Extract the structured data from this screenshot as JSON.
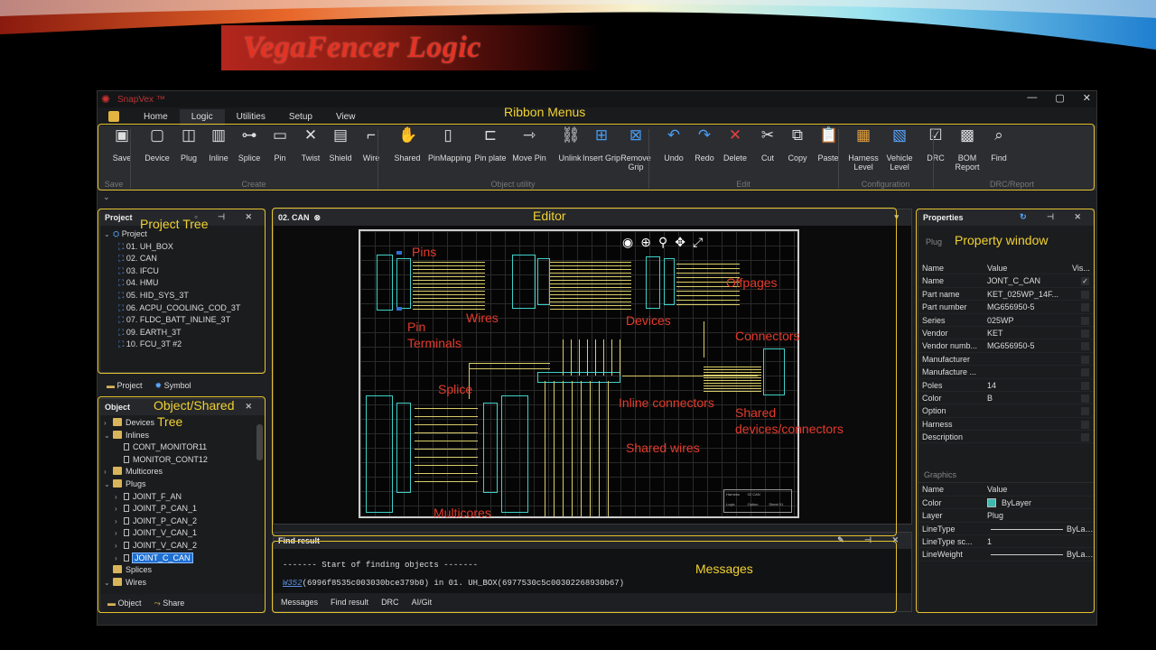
{
  "slide": {
    "title": "VegaFencer Logic"
  },
  "app": {
    "name": "SnapVex ™",
    "window_controls": [
      "—",
      "▢",
      "✕"
    ],
    "menu_tabs": [
      "Home",
      "Logic",
      "Utilities",
      "Setup",
      "View"
    ],
    "active_tab": "Logic"
  },
  "ribbon": {
    "buttons": [
      {
        "label": "Save",
        "icon": "save-icon"
      },
      {
        "label": "Device",
        "icon": "device-icon"
      },
      {
        "label": "Plug",
        "icon": "plug-icon"
      },
      {
        "label": "Inline",
        "icon": "inline-icon"
      },
      {
        "label": "Splice",
        "icon": "splice-icon"
      },
      {
        "label": "Pin",
        "icon": "pin-icon"
      },
      {
        "label": "Twist",
        "icon": "twist-icon"
      },
      {
        "label": "Shield",
        "icon": "shield-icon"
      },
      {
        "label": "Wire",
        "icon": "wire-icon"
      },
      {
        "label": "Shared",
        "icon": "shared-icon"
      },
      {
        "label": "PinMapping",
        "icon": "pinmapping-icon"
      },
      {
        "label": "Pin plate",
        "icon": "pin-plate-icon"
      },
      {
        "label": "Move Pin",
        "icon": "move-pin-icon"
      },
      {
        "label": "Unlink",
        "icon": "unlink-icon"
      },
      {
        "label": "Insert Grip",
        "icon": "insert-grip-icon"
      },
      {
        "label": "Remove Grip",
        "icon": "remove-grip-icon"
      },
      {
        "label": "Undo",
        "icon": "undo-icon"
      },
      {
        "label": "Redo",
        "icon": "redo-icon"
      },
      {
        "label": "Delete",
        "icon": "delete-icon"
      },
      {
        "label": "Cut",
        "icon": "cut-icon"
      },
      {
        "label": "Copy",
        "icon": "copy-icon"
      },
      {
        "label": "Paste",
        "icon": "paste-icon"
      },
      {
        "label": "Harness Level",
        "icon": "harness-level-icon"
      },
      {
        "label": "Vehicle Level",
        "icon": "vehicle-level-icon"
      },
      {
        "label": "DRC",
        "icon": "drc-icon"
      },
      {
        "label": "BOM Report",
        "icon": "bom-report-icon"
      },
      {
        "label": "Find",
        "icon": "find-icon"
      }
    ],
    "groups": [
      "Save",
      "Create",
      "Object utility",
      "Edit",
      "Configuration",
      "DRC/Report"
    ]
  },
  "project_panel": {
    "title": "Project",
    "root": "Project",
    "items": [
      "01. UH_BOX",
      "02. CAN",
      "03. IFCU",
      "04. HMU",
      "05. HID_SYS_3T",
      "06. ACPU_COOLING_COD_3T",
      "07. FLDC_BATT_INLINE_3T",
      "09. EARTH_3T",
      "10. FCU_3T #2"
    ],
    "tabs": [
      "Project",
      "Symbol"
    ]
  },
  "object_panel": {
    "title": "Object",
    "rows": [
      {
        "label": "Devices",
        "kind": "folder",
        "level": 0,
        "expand": "›"
      },
      {
        "label": "Inlines",
        "kind": "folder",
        "level": 0,
        "expand": "⌄"
      },
      {
        "label": "CONT_MONITOR11",
        "kind": "plug",
        "level": 1,
        "expand": ""
      },
      {
        "label": "MONITOR_CONT12",
        "kind": "plug",
        "level": 1,
        "expand": ""
      },
      {
        "label": "Multicores",
        "kind": "folder",
        "level": 0,
        "expand": "›"
      },
      {
        "label": "Plugs",
        "kind": "folder",
        "level": 0,
        "expand": "⌄"
      },
      {
        "label": "JOINT_F_AN",
        "kind": "plug",
        "level": 1,
        "expand": "›"
      },
      {
        "label": "JOINT_P_CAN_1",
        "kind": "plug",
        "level": 1,
        "expand": "›"
      },
      {
        "label": "JOINT_P_CAN_2",
        "kind": "plug",
        "level": 1,
        "expand": "›"
      },
      {
        "label": "JOINT_V_CAN_1",
        "kind": "plug",
        "level": 1,
        "expand": "›"
      },
      {
        "label": "JOINT_V_CAN_2",
        "kind": "plug",
        "level": 1,
        "expand": "›"
      },
      {
        "label": "JOINT_C_CAN",
        "kind": "plug",
        "level": 1,
        "expand": "›",
        "selected": true
      },
      {
        "label": "Splices",
        "kind": "folder",
        "level": 0,
        "expand": ""
      },
      {
        "label": "Wires",
        "kind": "folder",
        "level": 0,
        "expand": "⌄"
      }
    ],
    "tabs": [
      "Object",
      "Share"
    ]
  },
  "editor": {
    "tab": "02. CAN",
    "close": "⊗",
    "title_block": [
      "Harness",
      "02 CAN",
      "Logic",
      "Option",
      "Sheet 01"
    ]
  },
  "messages": {
    "title": "Find result",
    "line1": "------- Start of finding objects -------",
    "link": "W352",
    "line2_rest": "(6996f8535c003030bce379b0) in 01. UH_BOX(6977530c5c00302268930b67)",
    "tabs": [
      "Messages",
      "Find result",
      "DRC",
      "AI/Git"
    ]
  },
  "properties": {
    "title": "Properties",
    "section": "Plug",
    "headers": [
      "Name",
      "Value",
      "Vis..."
    ],
    "rows": [
      {
        "name": "Name",
        "value": "JONT_C_CAN",
        "check": "✓"
      },
      {
        "name": "Part name",
        "value": "KET_025WP_14F...",
        "check": ""
      },
      {
        "name": "Part number",
        "value": "MG656950-5",
        "check": ""
      },
      {
        "name": "Series",
        "value": "025WP",
        "check": ""
      },
      {
        "name": "Vendor",
        "value": "KET",
        "check": ""
      },
      {
        "name": "Vendor numb...",
        "value": "MG656950-5",
        "check": ""
      },
      {
        "name": "Manufacturer",
        "value": "",
        "check": ""
      },
      {
        "name": "Manufacture ...",
        "value": "",
        "check": ""
      },
      {
        "name": "Poles",
        "value": "14",
        "check": ""
      },
      {
        "name": "Color",
        "value": "B",
        "check": ""
      },
      {
        "name": "Option",
        "value": "",
        "check": ""
      },
      {
        "name": "Harness",
        "value": "",
        "check": ""
      },
      {
        "name": "Description",
        "value": "",
        "check": ""
      }
    ],
    "graphics_title": "Graphics",
    "graphics_headers": [
      "Name",
      "Value"
    ],
    "graphics_rows": [
      {
        "name": "Color",
        "value": "ByLayer",
        "extra": ""
      },
      {
        "name": "Layer",
        "value": "Plug",
        "extra": ""
      },
      {
        "name": "LineType",
        "value": "",
        "extra": "ByLayer"
      },
      {
        "name": "LineType sc...",
        "value": "1",
        "extra": ""
      },
      {
        "name": "LineWeight",
        "value": "",
        "extra": "ByLayer"
      }
    ],
    "swatch_color": "#3fb8b0"
  },
  "annotations": {
    "ribbon": "Ribbon Menus",
    "project_tree": "Project Tree",
    "editor": "Editor",
    "property_window": "Property window",
    "object_tree_1": "Object/Shared",
    "object_tree_2": "Tree",
    "messages": "Messages",
    "pins": "Pins",
    "wires": "Wires",
    "pin_terminals_1": "Pin",
    "pin_terminals_2": "Terminals",
    "devices": "Devices",
    "offpages": "Offpages",
    "connectors": "Connectors",
    "splice": "Splice",
    "inline_connectors": "Inline connectors",
    "shared_1": "Shared",
    "shared_2": "devices/connectors",
    "shared_wires": "Shared wires",
    "multicores": "Multicores"
  },
  "colors": {
    "annotation_yellow": "#f1d233",
    "annotation_red": "#e53b2c",
    "component_cyan": "#3fd0c8",
    "wire_yellow": "#d9cd6a"
  }
}
